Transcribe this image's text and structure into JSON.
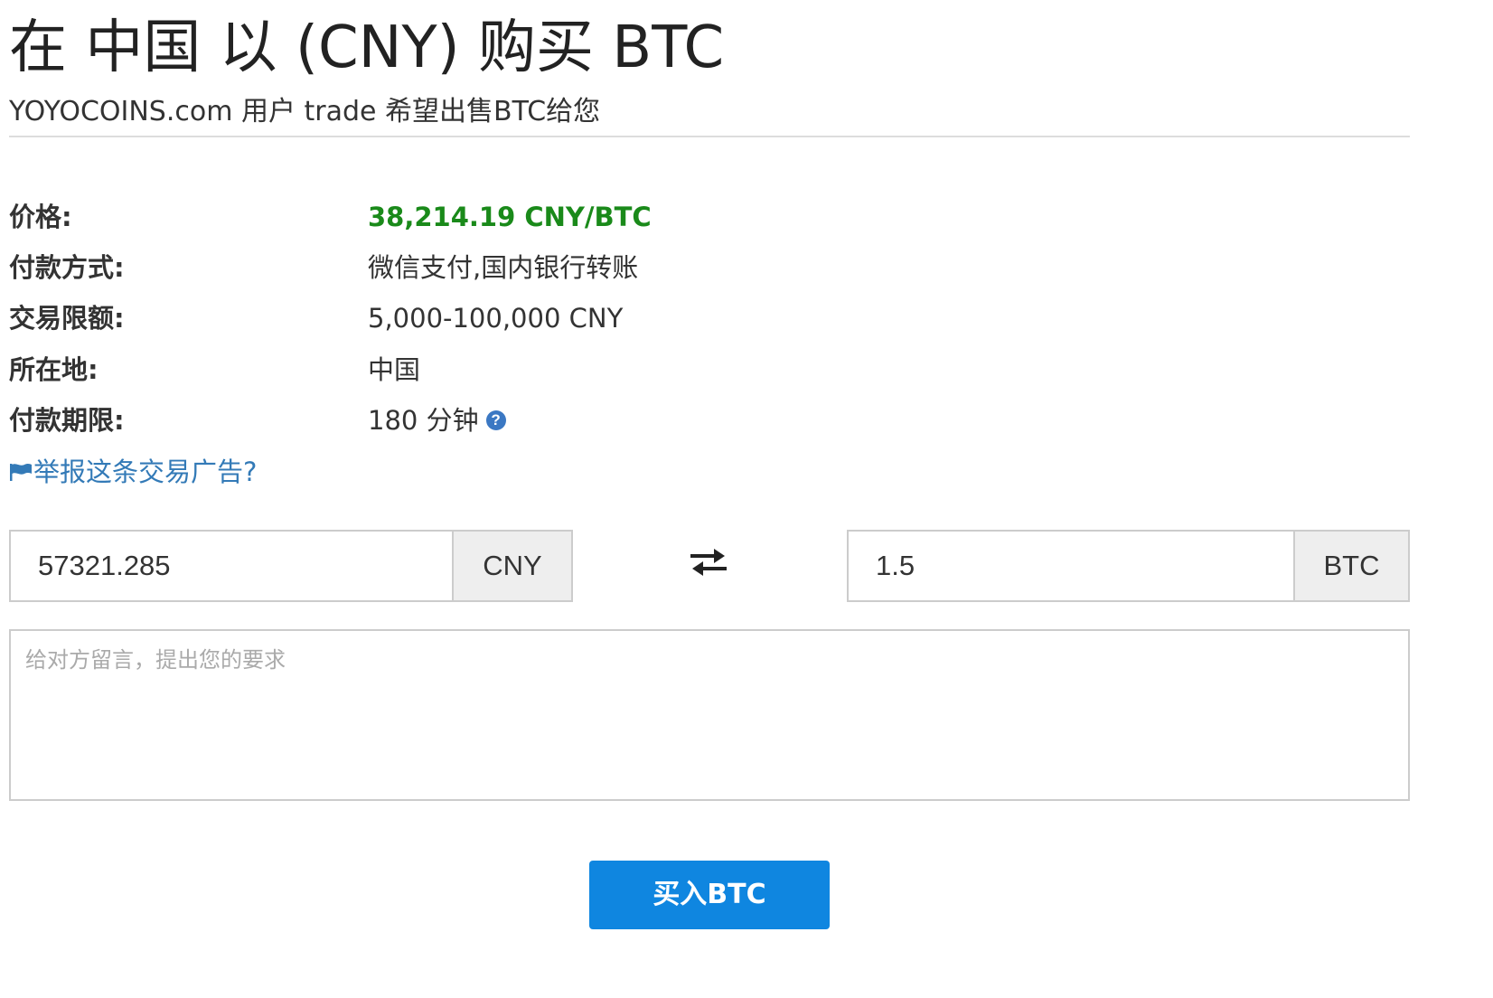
{
  "header": {
    "title": "在 中国 以 (CNY) 购买 BTC",
    "subtitle": "YOYOCOINS.com 用户 trade 希望出售BTC给您"
  },
  "details": {
    "price_label": "价格:",
    "price_value": "38,214.19 CNY/BTC",
    "payment_method_label": "付款方式:",
    "payment_method_value": "微信支付,国内银行转账",
    "limit_label": "交易限额:",
    "limit_value": "5,000-100,000 CNY",
    "location_label": "所在地:",
    "location_value": "中国",
    "payment_window_label": "付款期限:",
    "payment_window_value": "180 分钟",
    "help_symbol": "?"
  },
  "report": {
    "label": "举报这条交易广告?",
    "icon": "flag-icon"
  },
  "trade_form": {
    "cny_amount": "57321.285",
    "cny_currency": "CNY",
    "swap_icon": "exchange-arrows-icon",
    "btc_amount": "1.5",
    "btc_currency": "BTC",
    "message_placeholder": "给对方留言，提出您的要求",
    "submit_label": "买入BTC"
  },
  "colors": {
    "price": "#1a8a1a",
    "link": "#337ab7",
    "help_icon": "#3b78c3",
    "button": "#0f86e0",
    "addon_bg": "#eeeeee",
    "border": "#cccccc"
  }
}
